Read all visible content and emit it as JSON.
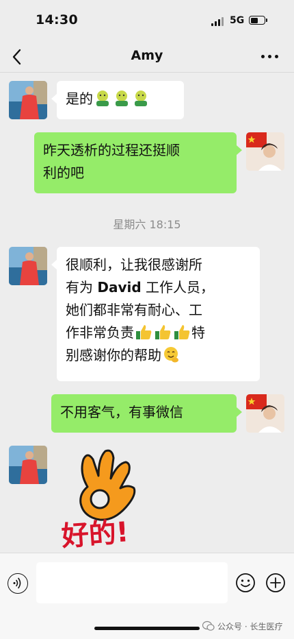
{
  "status_bar": {
    "time": "14:30",
    "network": "5G"
  },
  "header": {
    "title": "Amy"
  },
  "messages": [
    {
      "side": "left",
      "text": "是的",
      "emoji": [
        "face-with-medical-mask-hugging",
        "face-with-medical-mask-hugging",
        "face-with-medical-mask-hugging"
      ]
    },
    {
      "side": "right",
      "line1": "昨天透析的过程还挺顺",
      "line2": "利的吧"
    },
    {
      "side": "left",
      "line1": "很顺利，让我很感谢所",
      "line2_a": "有为 ",
      "line2_name": "David",
      "line2_b": " 工作人员，",
      "line3": "她们都非常有耐心、工",
      "line4_a": "作非常负责",
      "line4_b": "特",
      "line5": "别感谢你的帮助",
      "emoji": [
        "thumbs-up",
        "thumbs-up",
        "thumbs-up",
        "smiling-face-with-hand"
      ]
    },
    {
      "side": "right",
      "text": "不用客气，有事微信"
    },
    {
      "side": "left",
      "sticker": "ok-hand",
      "sticker_text": "好的!"
    }
  ],
  "timestamp": "星期六 18:15",
  "watermark": "公众号 · 长生医疗",
  "colors": {
    "background": "#ededed",
    "sent_bubble": "#95ec69",
    "received_bubble": "#ffffff",
    "sticker_text": "#d8142b"
  }
}
